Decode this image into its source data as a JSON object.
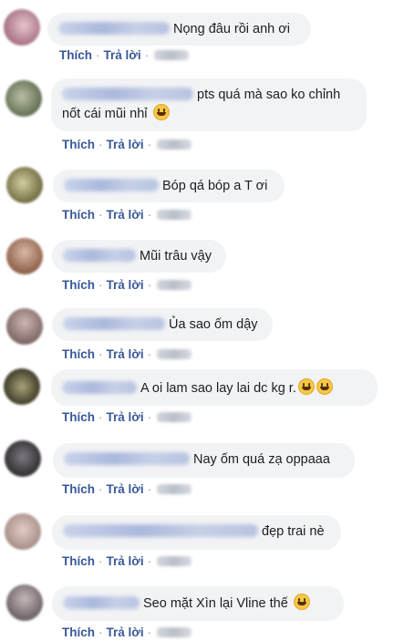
{
  "actions": {
    "like_label": "Thích",
    "reply_label": "Trả lời",
    "separator": "·"
  },
  "comments": [
    {
      "text": "Nọng đâu rồi anh ơi",
      "emojis": 0,
      "avatar_color": "#b07d8e"
    },
    {
      "text": "pts quá mà sao ko chỉnh",
      "text_line2": "nốt cái mũi nhỉ",
      "emojis": 1,
      "avatar_color": "#6f7a5e"
    },
    {
      "text": "Bóp qá bóp a T ơi",
      "emojis": 0,
      "avatar_color": "#7d7a4e"
    },
    {
      "text": "Mũi trâu vậy",
      "emojis": 0,
      "avatar_color": "#9a6e58"
    },
    {
      "text": "Ủa sao ốm dậy",
      "emojis": 0,
      "avatar_color": "#8a7370"
    },
    {
      "text": "A oi lam sao lay lai dc kg r.",
      "emojis": 2,
      "avatar_color": "#4e4b34"
    },
    {
      "text": "Nay ốm quá zạ oppaaa",
      "emojis": 0,
      "avatar_color": "#3c3a3d"
    },
    {
      "text": "đẹp trai nè",
      "emojis": 0,
      "avatar_color": "#b29891"
    },
    {
      "text": "Seo mặt Xìn lại Vline thế",
      "emojis": 1,
      "avatar_color": "#7a6f72"
    }
  ]
}
